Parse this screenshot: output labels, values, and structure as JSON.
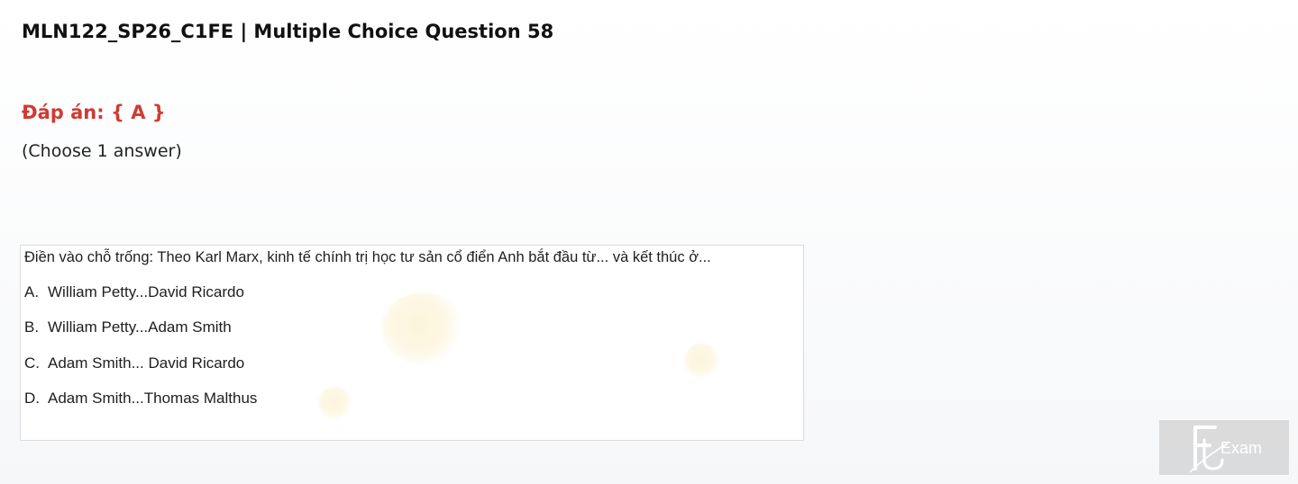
{
  "page": {
    "title": "MLN122_SP26_C1FE | Multiple Choice Question 58",
    "answer_label": "Đáp án: { A }",
    "instruction": "(Choose 1 answer)"
  },
  "question": {
    "text": "Điền vào chỗ trống: Theo Karl Marx, kinh tế chính trị học tư sản cổ điển Anh bắt đầu từ... và kết thúc ở...",
    "options": [
      {
        "letter": "A.",
        "text": "William Petty...David Ricardo"
      },
      {
        "letter": "B.",
        "text": "William Petty...Adam Smith"
      },
      {
        "letter": "C.",
        "text": "Adam Smith... David Ricardo"
      },
      {
        "letter": "D.",
        "text": "Adam Smith...Thomas Malthus"
      }
    ]
  },
  "watermark": {
    "text": "Exam",
    "icon": "fu-logo-icon"
  },
  "colors": {
    "answer": "#d03a32",
    "title": "#111111",
    "watermark_bg": "#c8c8c8"
  }
}
